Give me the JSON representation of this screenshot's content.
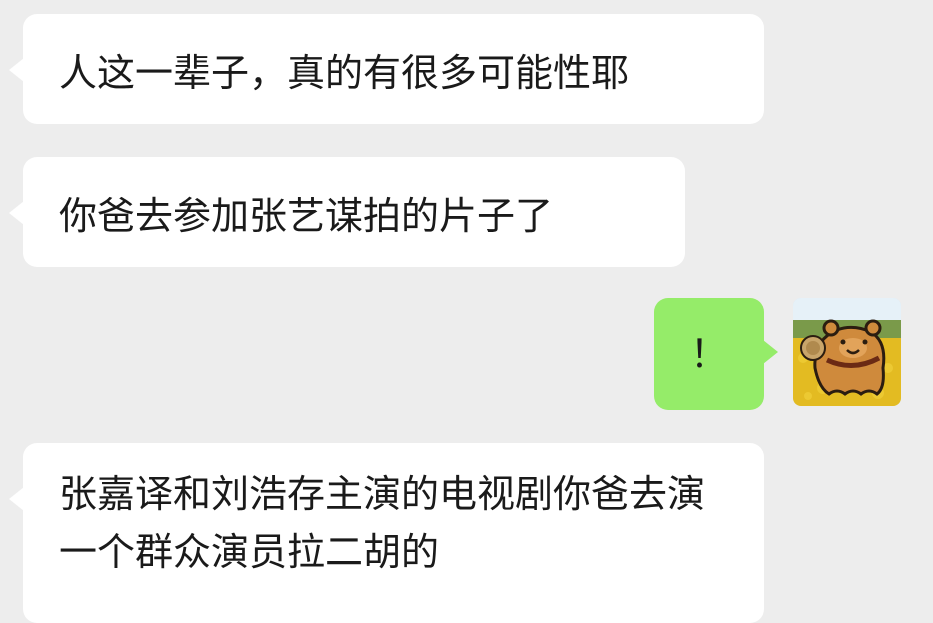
{
  "chat": {
    "messages": [
      {
        "from": "other",
        "text": "人这一辈子，真的有很多可能性耶"
      },
      {
        "from": "other",
        "text": "你爸去参加张艺谋拍的片子了"
      },
      {
        "from": "me",
        "text": "！"
      },
      {
        "from": "other",
        "text": "张嘉译和刘浩存主演的电视剧你爸去演一个群众演员拉二胡的"
      }
    ],
    "colors": {
      "background": "#ededed",
      "incoming_bubble": "#ffffff",
      "outgoing_bubble": "#95ec69",
      "text": "#1a1a1a"
    },
    "avatar_icon": "capybara-avatar-icon"
  }
}
